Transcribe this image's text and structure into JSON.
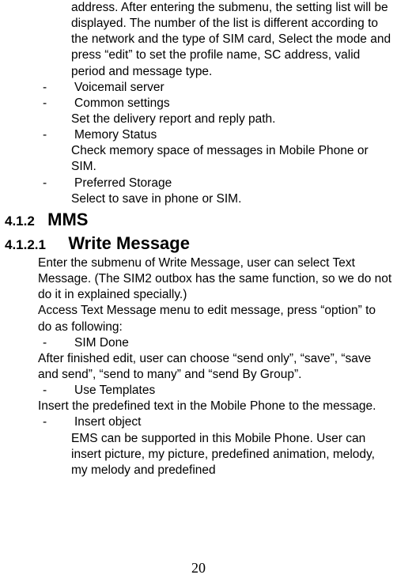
{
  "top_continuation": "address. After entering the submenu, the setting list will be displayed. The number of the list is different according to the network and the type of SIM card, Select the mode and press “edit” to set the profile name, SC address, valid period and message type.",
  "items1": [
    {
      "dash": "-",
      "label": "Voicemail server",
      "desc": ""
    },
    {
      "dash": "-",
      "label": "Common settings",
      "desc": "Set the delivery report and reply path."
    },
    {
      "dash": "-",
      "label": "Memory Status",
      "desc": "Check memory space of messages in Mobile Phone or SIM."
    },
    {
      "dash": "-",
      "label": "Preferred Storage",
      "desc": "Select to save in phone or SIM."
    }
  ],
  "heading_mms_num": "4.1.2",
  "heading_mms_title": "MMS",
  "heading_write_num": "4.1.2.1",
  "heading_write_title": "Write Message",
  "write_intro1": "Enter the submenu of Write Message, user can select Text Message. (The SIM2 outbox has the same function, so we do not do it in explained specially.)",
  "write_intro2": "Access Text Message menu to edit message, press “option” to do as following:",
  "items2": [
    {
      "dash": "-",
      "label": "SIM Done",
      "desc": "After finished edit, user can choose “send only”, “save”, “save and send”, “send to many” and “send By Group”.",
      "desc_inline": true
    },
    {
      "dash": "-",
      "label": "Use Templates",
      "desc": "Insert the predefined text in the Mobile Phone to the message.",
      "desc_inline": true
    },
    {
      "dash": "-",
      "label": "Insert object",
      "desc": "EMS can be supported in this Mobile Phone. User can insert picture, my picture, predefined animation, melody, my melody and predefined",
      "desc_inline": false
    }
  ],
  "page_number": "20"
}
